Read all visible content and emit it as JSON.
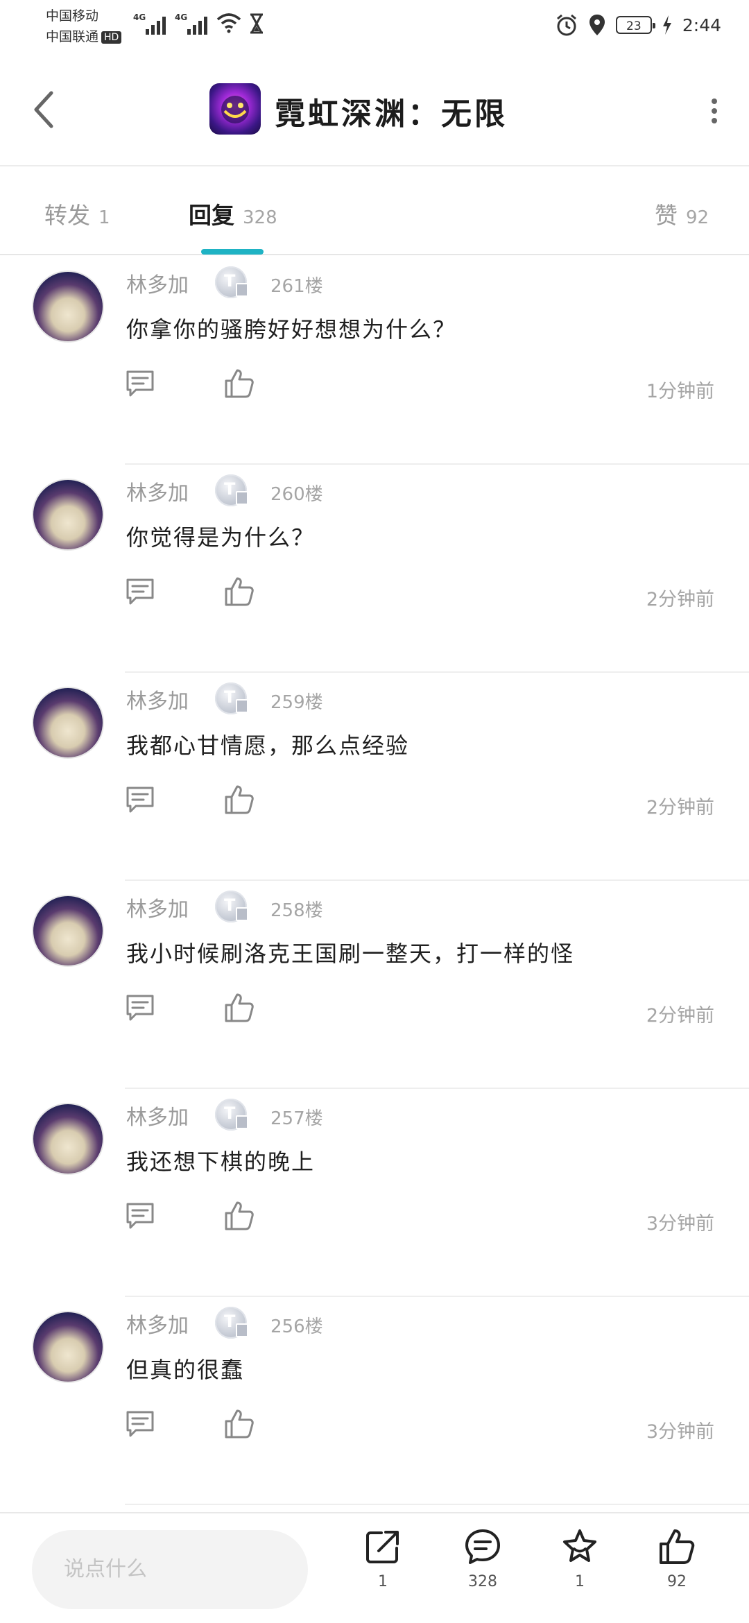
{
  "status_bar": {
    "carrier1": "中国移动",
    "carrier2": "中国联通",
    "hd": "HD",
    "net1": "4G",
    "net2": "4G",
    "battery": "23",
    "time": "2:44"
  },
  "header": {
    "title": "霓虹深渊：无限"
  },
  "tabs": [
    {
      "label": "转发",
      "count": "1"
    },
    {
      "label": "回复",
      "count": "328"
    },
    {
      "label": "赞",
      "count": "92"
    }
  ],
  "replies": [
    {
      "user": "林多加",
      "badge": "T",
      "floor": "261楼",
      "content": "你拿你的骚胯好好想想为什么？",
      "time": "1分钟前"
    },
    {
      "user": "林多加",
      "badge": "T",
      "floor": "260楼",
      "content": "你觉得是为什么？",
      "time": "2分钟前"
    },
    {
      "user": "林多加",
      "badge": "T",
      "floor": "259楼",
      "content": "我都心甘情愿，那么点经验",
      "time": "2分钟前"
    },
    {
      "user": "林多加",
      "badge": "T",
      "floor": "258楼",
      "content": "我小时候刷洛克王国刷一整天，打一样的怪",
      "time": "2分钟前"
    },
    {
      "user": "林多加",
      "badge": "T",
      "floor": "257楼",
      "content": "我还想下棋的晚上",
      "time": "3分钟前"
    },
    {
      "user": "林多加",
      "badge": "T",
      "floor": "256楼",
      "content": "但真的很蠢",
      "time": "3分钟前"
    }
  ],
  "bottom_bar": {
    "input_placeholder": "说点什么",
    "share_count": "1",
    "comment_count": "328",
    "favorite_count": "1",
    "like_count": "92"
  },
  "colors": {
    "accent": "#1fb3c4"
  }
}
